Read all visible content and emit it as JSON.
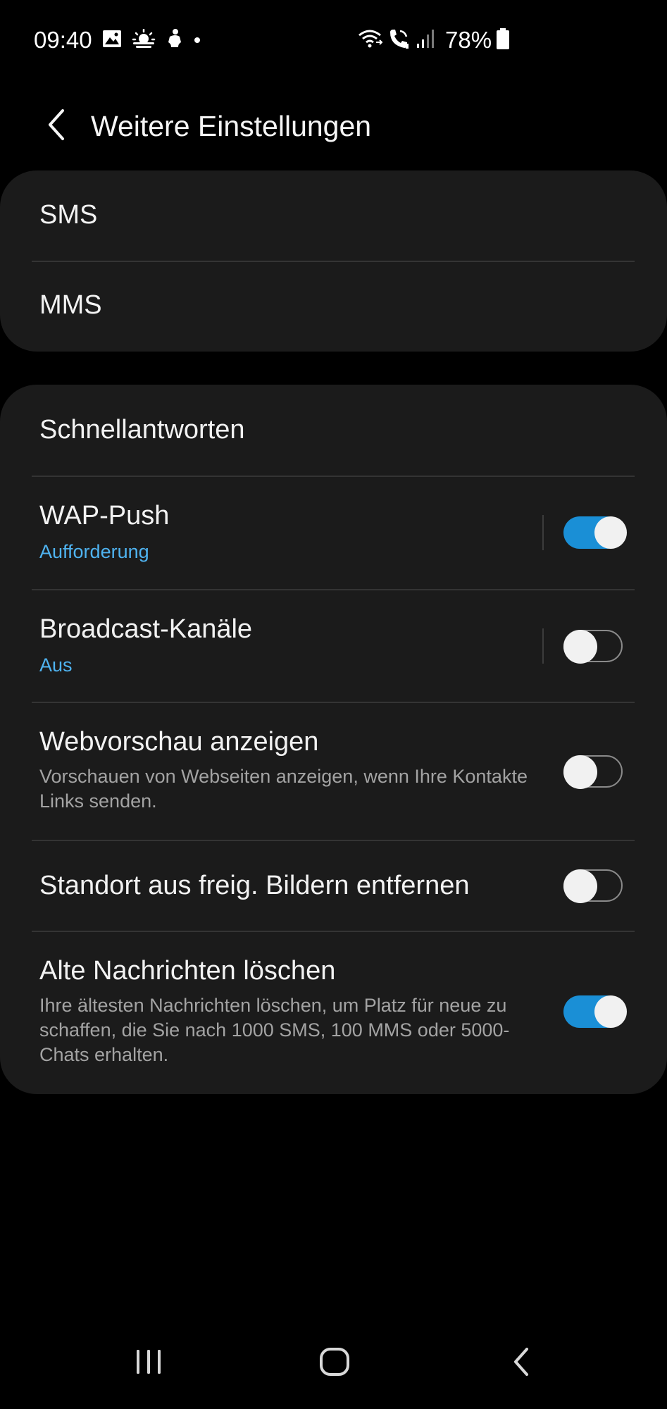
{
  "status_bar": {
    "time": "09:40",
    "battery_percent": "78%",
    "left_icons": [
      "gallery-icon",
      "weather-icon",
      "notification-icon",
      "dot-icon"
    ],
    "right_icons": [
      "wifi-calling-icon",
      "volte-call-icon",
      "signal-icon",
      "battery-icon"
    ]
  },
  "header": {
    "title": "Weitere Einstellungen",
    "back_icon": "chevron-left-icon"
  },
  "section1": {
    "items": [
      {
        "title": "SMS"
      },
      {
        "title": "MMS"
      }
    ]
  },
  "section2": {
    "items": [
      {
        "title": "Schnellantworten"
      },
      {
        "title": "WAP-Push",
        "subtitle": "Aufforderung",
        "toggle": true
      },
      {
        "title": "Broadcast-Kanäle",
        "subtitle": "Aus",
        "toggle": false
      },
      {
        "title": "Webvorschau anzeigen",
        "description": "Vorschauen von Webseiten anzeigen, wenn Ihre Kontakte Links senden.",
        "toggle": false
      },
      {
        "title": "Standort aus freig. Bildern entfernen",
        "toggle": false
      },
      {
        "title": "Alte Nachrichten löschen",
        "description": "Ihre ältesten Nachrichten löschen, um Platz für neue zu schaffen, die Sie nach 1000 SMS, 100 MMS oder 5000-Chats erhalten.",
        "toggle": true
      }
    ]
  },
  "nav_bar": {
    "buttons": [
      "recents-icon",
      "home-icon",
      "back-icon"
    ]
  },
  "colors": {
    "background": "#000000",
    "card": "#1b1b1b",
    "accent_text": "#4fb3f0",
    "toggle_on": "#1a8fd6",
    "secondary_text": "#a3a3a3"
  }
}
